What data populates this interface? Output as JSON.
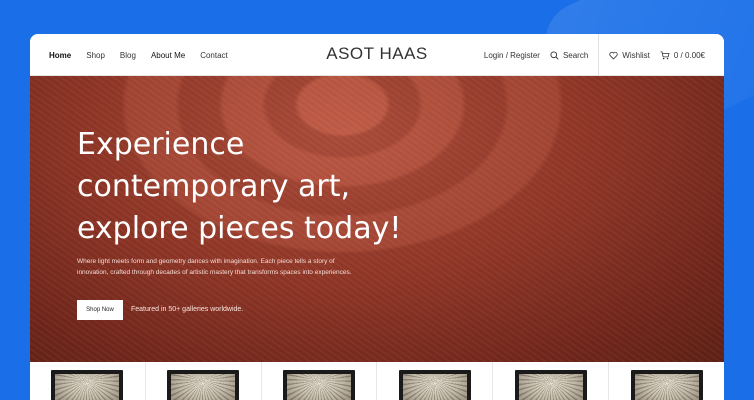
{
  "brand": "ASOT HAAS",
  "nav": {
    "items": [
      {
        "label": "Home"
      },
      {
        "label": "Shop"
      },
      {
        "label": "Blog"
      },
      {
        "label": "About Me"
      },
      {
        "label": "Contact"
      }
    ]
  },
  "header": {
    "login": "Login / Register",
    "search": "Search",
    "wishlist": "Wishlist",
    "cart": "0 / 0.00€"
  },
  "hero": {
    "title_line1": "Experience",
    "title_line2": "contemporary art,",
    "title_line3": "explore pieces today!",
    "description": "Where light meets form and geometry dances with imagination. Each piece tells a story of innovation, crafted through decades of artistic mastery that transforms spaces into experiences.",
    "button": "Shop Now",
    "featured": "Featured in 50+ galleries worldwide."
  },
  "colors": {
    "page_background": "#1a6fe8",
    "hero_red": "#8e3526"
  }
}
